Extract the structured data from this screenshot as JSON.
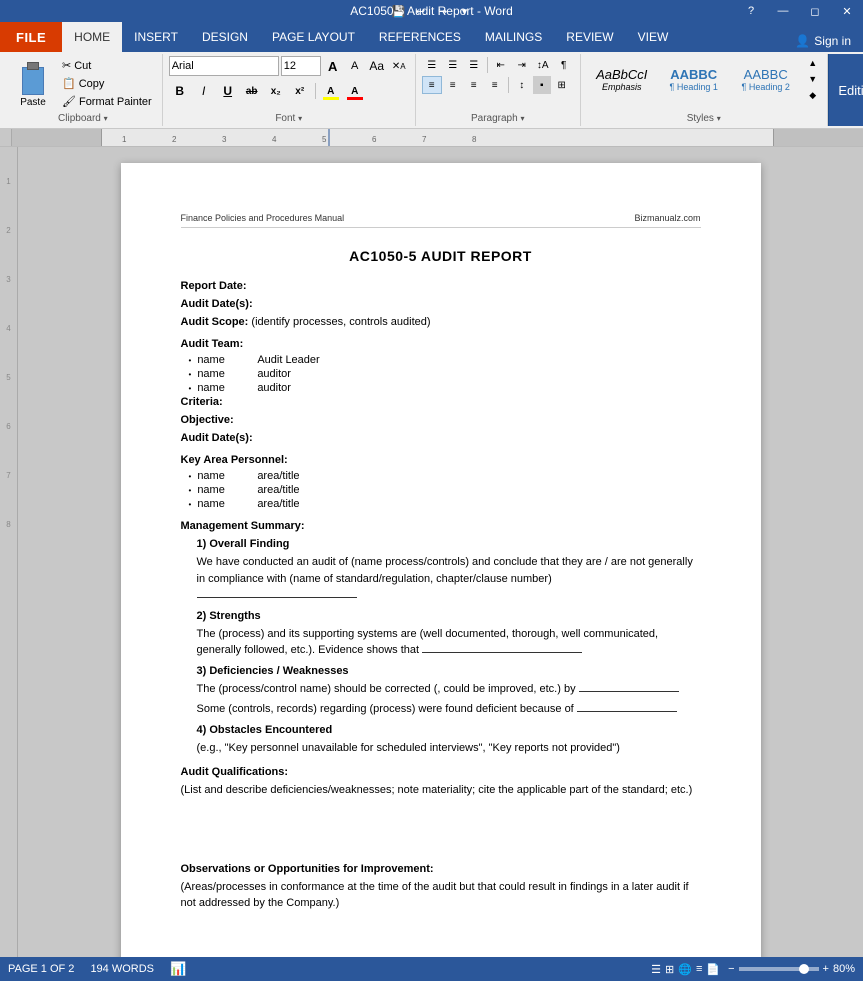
{
  "window": {
    "title": "AC1050-5 Audit Report - Word"
  },
  "qat": {
    "save_label": "💾",
    "undo_label": "↩",
    "redo_label": "↪",
    "customize_label": "▾"
  },
  "ribbon": {
    "tabs": [
      {
        "id": "file",
        "label": "FILE",
        "active": false
      },
      {
        "id": "home",
        "label": "HOME",
        "active": true
      },
      {
        "id": "insert",
        "label": "INSERT",
        "active": false
      },
      {
        "id": "design",
        "label": "DESIGN",
        "active": false
      },
      {
        "id": "page_layout",
        "label": "PAGE LAYOUT",
        "active": false
      },
      {
        "id": "references",
        "label": "REFERENCES",
        "active": false
      },
      {
        "id": "mailings",
        "label": "MAILINGS",
        "active": false
      },
      {
        "id": "review",
        "label": "REVIEW",
        "active": false
      },
      {
        "id": "view",
        "label": "VIEW",
        "active": false
      }
    ],
    "sign_in": "Sign in",
    "groups": {
      "clipboard": {
        "label": "Clipboard",
        "paste_label": "Paste",
        "cut_label": "Cut",
        "copy_label": "Copy",
        "format_painter_label": "Format Painter"
      },
      "font": {
        "label": "Font",
        "font_name": "Arial",
        "font_size": "12",
        "bold": "B",
        "italic": "I",
        "underline": "U",
        "strikethrough": "ab",
        "subscript": "x₂",
        "superscript": "x²",
        "text_color_label": "A",
        "highlight_label": "A",
        "clear_format": "clear"
      },
      "paragraph": {
        "label": "Paragraph"
      },
      "styles": {
        "label": "Styles",
        "items": [
          {
            "id": "emphasis",
            "label": "AaBbCcI",
            "name": "Emphasis"
          },
          {
            "id": "heading1",
            "label": "AABBC",
            "name": "¶ Heading 1"
          },
          {
            "id": "heading2",
            "label": "AABBC",
            "name": "¶ Heading 2"
          }
        ]
      },
      "editing": {
        "label": "Editing"
      }
    }
  },
  "document": {
    "header_left": "Finance Policies and Procedures Manual",
    "header_right": "Bizmanualz.com",
    "title": "AC1050-5 AUDIT REPORT",
    "fields": [
      {
        "label": "Report Date:",
        "value": ""
      },
      {
        "label": "Audit Date(s):",
        "value": ""
      },
      {
        "label": "Audit Scope:",
        "value": "(identify processes, controls audited)"
      }
    ],
    "audit_team": {
      "label": "Audit Team:",
      "members": [
        {
          "name": "name",
          "role": "Audit Leader"
        },
        {
          "name": "name",
          "role": "auditor"
        },
        {
          "name": "name",
          "role": "auditor"
        }
      ]
    },
    "criteria_label": "Criteria:",
    "objective_label": "Objective:",
    "audit_dates_label": "Audit Date(s):",
    "key_personnel": {
      "label": "Key Area Personnel:",
      "members": [
        {
          "name": "name",
          "role": "area/title"
        },
        {
          "name": "name",
          "role": "area/title"
        },
        {
          "name": "name",
          "role": "area/title"
        }
      ]
    },
    "management_summary": {
      "label": "Management Summary:",
      "sections": [
        {
          "title": "1) Overall Finding",
          "body": "We have conducted an audit of (name process/controls) and conclude that they are / are not generally in compliance with (name of standard/regulation, chapter/clause number)"
        },
        {
          "title": "2) Strengths",
          "body": "The (process) and its supporting systems are (well documented, thorough, well communicated, generally followed, etc.).  Evidence shows that"
        },
        {
          "title": "3) Deficiencies / Weaknesses",
          "line1": "The (process/control name) should be corrected (, could be improved, etc.) by",
          "line2": "Some (controls, records) regarding (process) were found deficient because of"
        },
        {
          "title": "4) Obstacles Encountered",
          "body": "(e.g., \"Key personnel unavailable for scheduled interviews\", \"Key reports not provided\")"
        }
      ]
    },
    "audit_qualifications": {
      "label": "Audit Qualifications:",
      "body": "(List and describe deficiencies/weaknesses; note materiality; cite the applicable part of the standard; etc.)"
    },
    "observations": {
      "label": "Observations or Opportunities for Improvement:",
      "body": "(Areas/processes in conformance at the time of the audit but that could result in findings in a later audit if not addressed by the Company.)"
    }
  },
  "status": {
    "page": "PAGE 1 OF 2",
    "words": "194 WORDS",
    "zoom": "80%",
    "zoom_value": 80
  }
}
